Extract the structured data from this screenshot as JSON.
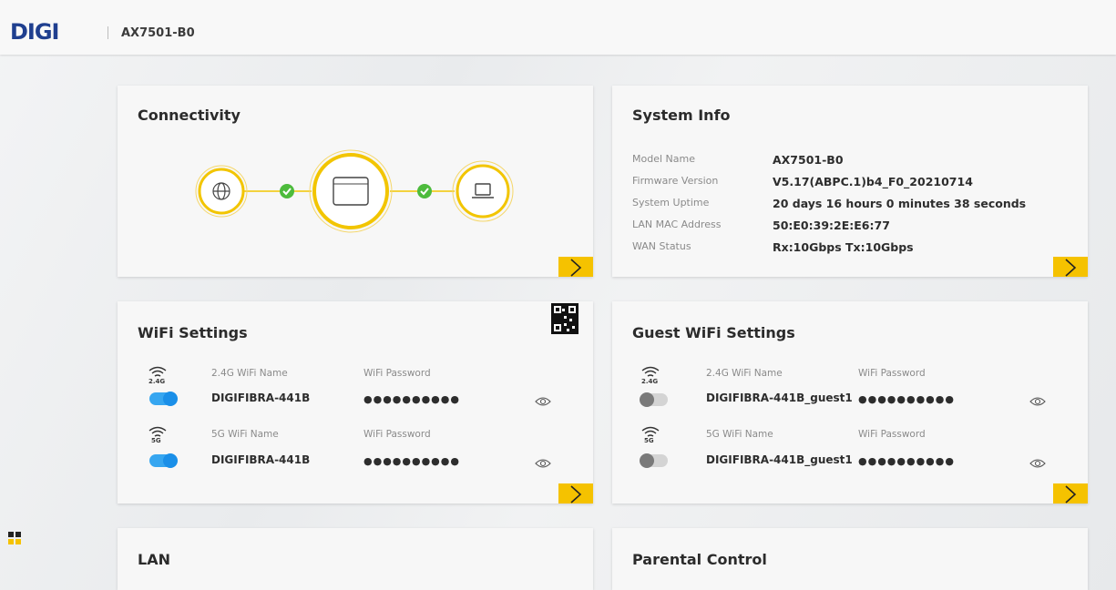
{
  "header": {
    "logo_text": "DIGI",
    "model": "AX7501-B0"
  },
  "connectivity": {
    "title": "Connectivity",
    "status_color": "#4dbb3c",
    "ring_color": "#f2c500"
  },
  "system_info": {
    "title": "System Info",
    "rows": [
      {
        "label": "Model Name",
        "value": "AX7501-B0"
      },
      {
        "label": "Firmware Version",
        "value": "V5.17(ABPC.1)b4_F0_20210714"
      },
      {
        "label": "System Uptime",
        "value": "20 days 16 hours 0 minutes 38 seconds"
      },
      {
        "label": "LAN MAC Address",
        "value": "50:E0:39:2E:E6:77"
      },
      {
        "label": "WAN Status",
        "value": "Rx:10Gbps Tx:10Gbps"
      }
    ]
  },
  "wifi": {
    "title": "WiFi Settings",
    "bands": [
      {
        "band_icon": "2.4G",
        "name_label": "2.4G WiFi Name",
        "name": "DIGIFIBRA-441B",
        "pw_label": "WiFi Password",
        "pw": "●●●●●●●●●●",
        "enabled": true
      },
      {
        "band_icon": "5G",
        "name_label": "5G WiFi Name",
        "name": "DIGIFIBRA-441B",
        "pw_label": "WiFi Password",
        "pw": "●●●●●●●●●●",
        "enabled": true
      }
    ]
  },
  "guest_wifi": {
    "title": "Guest WiFi Settings",
    "bands": [
      {
        "band_icon": "2.4G",
        "name_label": "2.4G WiFi Name",
        "name": "DIGIFIBRA-441B_guest1",
        "pw_label": "WiFi Password",
        "pw": "●●●●●●●●●●",
        "enabled": false
      },
      {
        "band_icon": "5G",
        "name_label": "5G WiFi Name",
        "name": "DIGIFIBRA-441B_guest1",
        "pw_label": "WiFi Password",
        "pw": "●●●●●●●●●●",
        "enabled": false
      }
    ]
  },
  "lan": {
    "title": "LAN"
  },
  "parental": {
    "title": "Parental Control"
  },
  "colors": {
    "accent": "#f5c200",
    "toggle_on": "#36a6f0",
    "brand": "#1f3f8f"
  }
}
